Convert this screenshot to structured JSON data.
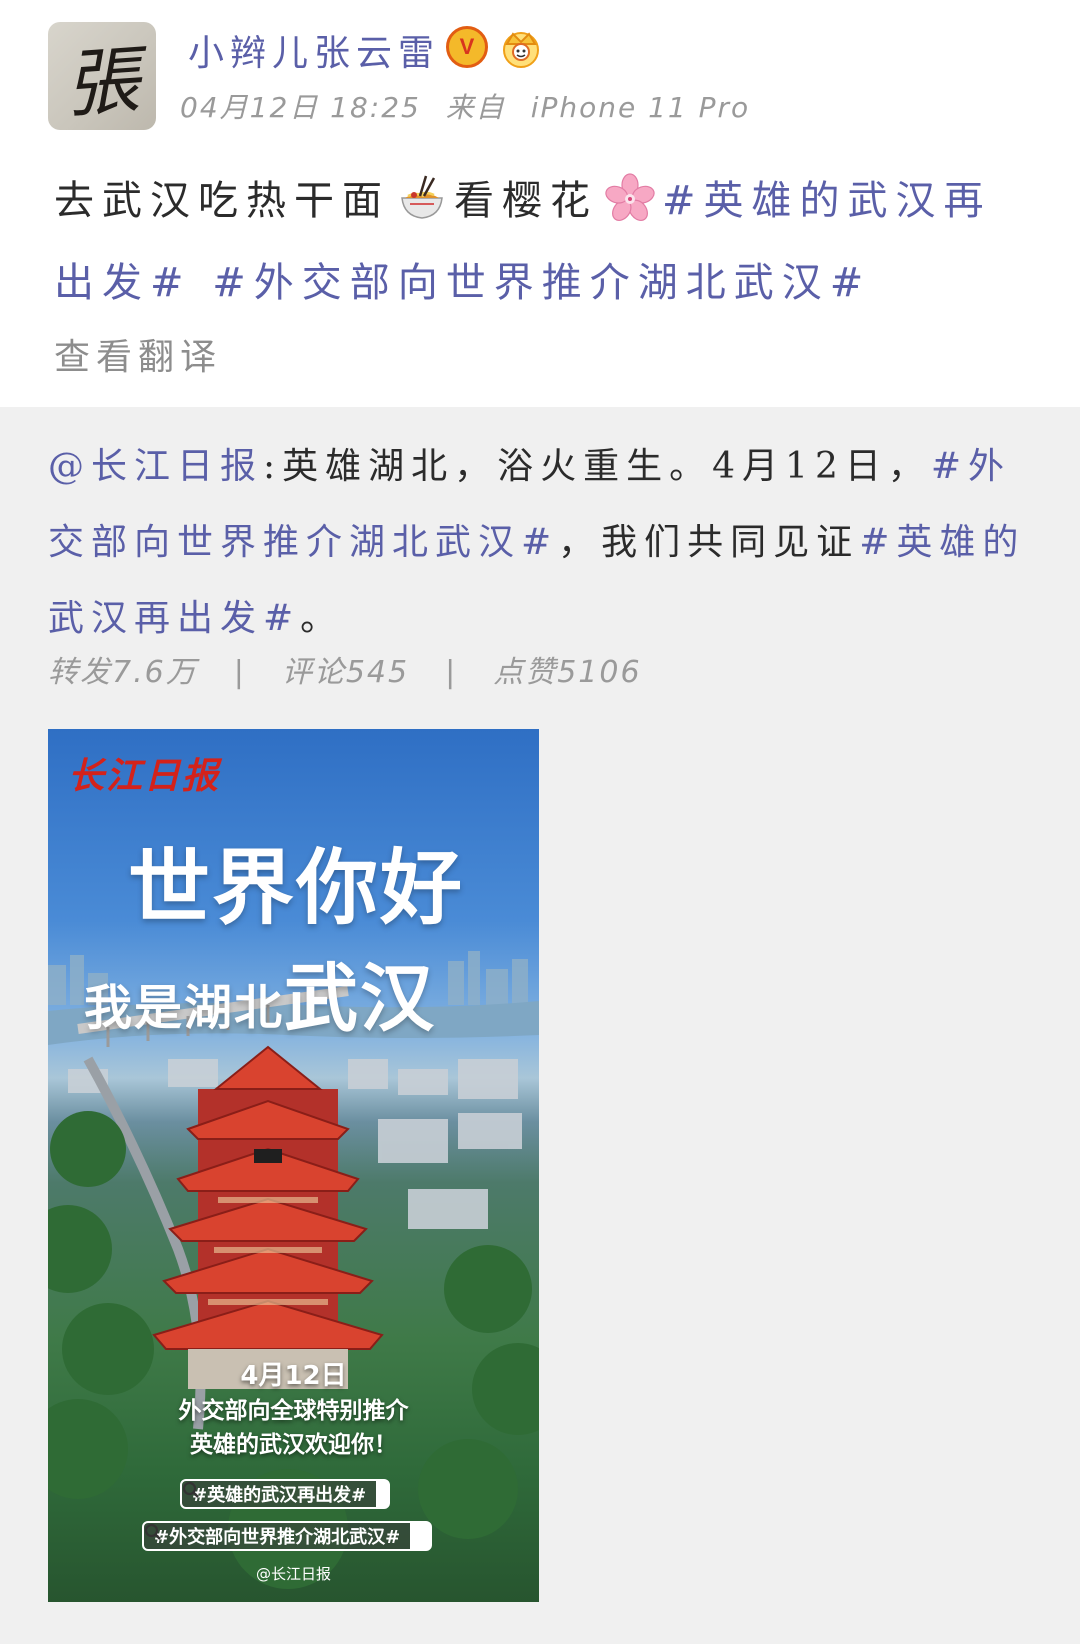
{
  "user": {
    "name": "小辫儿张云雷",
    "vip_badge": "V",
    "timestamp": "04月12日 18:25",
    "source_prefix": "来自",
    "device": "iPhone 11 Pro"
  },
  "post": {
    "text_a": "去武汉吃热干面",
    "text_b": "看樱花",
    "hashtag_1": "#英雄的武汉再出发#",
    "hashtag_2": "#外交部向世界推介湖北武汉#",
    "translate_label": "查看翻译"
  },
  "repost": {
    "mention": "@长江日报",
    "text_a": ":英雄湖北，浴火重生。4月12日，",
    "hashtag_1": "#外交部向世界推介湖北武汉#",
    "text_b": "，我们共同见证",
    "hashtag_2": "#英雄的武汉再出发#",
    "text_c": "。",
    "stats": {
      "reposts": "转发7.6万",
      "comments": "评论545",
      "likes": "点赞5106",
      "separator": "|"
    }
  },
  "poster": {
    "logo": "长江日报",
    "title_line1": "世界你好",
    "title_line2_a": "我是湖北",
    "title_line2_b": "武汉",
    "date": "4月12日",
    "line1": "外交部向全球特别推介",
    "line2": "英雄的武汉欢迎你！",
    "tag1": "#英雄的武汉再出发#",
    "tag2": "#外交部向世界推介湖北武汉#",
    "credit": "@长江日报"
  },
  "colors": {
    "link": "#5a5fa8",
    "text": "#2b2b2b",
    "muted": "#9a9a9a",
    "repost_bg": "#f0f0f0"
  }
}
